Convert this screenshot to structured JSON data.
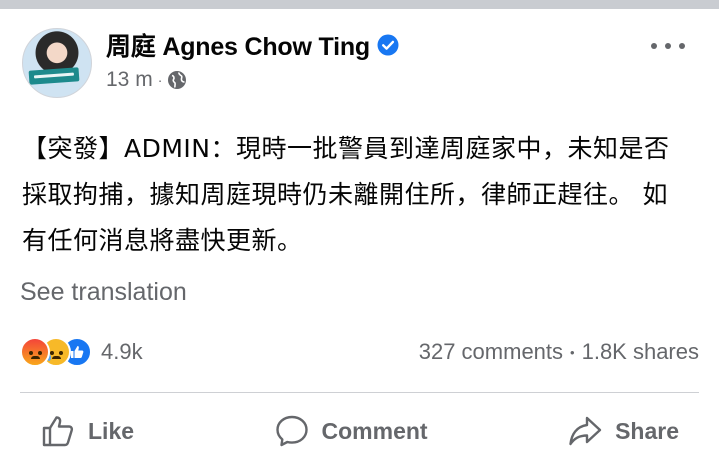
{
  "post": {
    "author": "周庭 Agnes Chow Ting",
    "time": "13 m",
    "meta_separator": "·",
    "text": "【突發】ADMIN：現時一批警員到達周庭家中，未知是否採取拘捕，據知周庭現時仍未離開住所，律師正趕往。 如有任何消息將盡快更新。",
    "see_translation": "See translation"
  },
  "stats": {
    "reaction_count": "4.9k",
    "comments": "327 comments",
    "separator": "•",
    "shares": "1.8K shares",
    "reactions": [
      "angry",
      "sad",
      "like"
    ]
  },
  "actions": {
    "like": "Like",
    "comment": "Comment",
    "share": "Share"
  },
  "icons": {
    "verified": "verified-badge-icon",
    "privacy": "globe-icon",
    "more": "more-options-icon"
  },
  "colors": {
    "accent": "#1877f2",
    "secondary_text": "#65676b",
    "primary_text": "#050505",
    "divider": "#ced0d4"
  }
}
